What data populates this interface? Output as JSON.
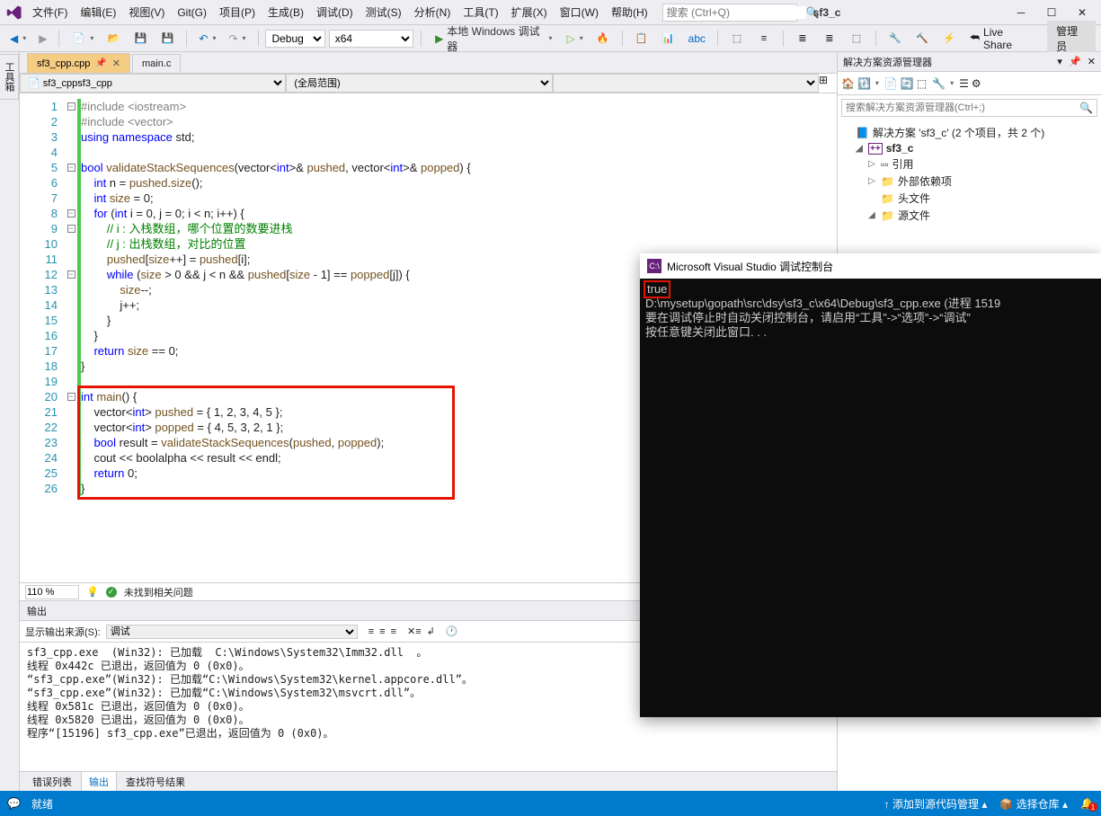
{
  "menu": {
    "items": [
      "文件(F)",
      "编辑(E)",
      "视图(V)",
      "Git(G)",
      "项目(P)",
      "生成(B)",
      "调试(D)",
      "测试(S)",
      "分析(N)",
      "工具(T)",
      "扩展(X)",
      "窗口(W)",
      "帮助(H)"
    ],
    "search_placeholder": "搜索 (Ctrl+Q)",
    "project": "sf3_c"
  },
  "toolbar": {
    "config": "Debug",
    "platform": "x64",
    "debug_label": "本地 Windows 调试器",
    "live_share": "Live Share",
    "admin": "管理员"
  },
  "tabs": {
    "active": "sf3_cpp.cpp",
    "others": [
      "main.c"
    ]
  },
  "nav": {
    "scope": "sf3_cpp",
    "member": "(全局范围)"
  },
  "code": {
    "lines": [
      "#include <iostream>",
      "#include <vector>",
      "using namespace std;",
      "",
      "bool validateStackSequences(vector<int>& pushed, vector<int>& popped) {",
      "    int n = pushed.size();",
      "    int size = 0;",
      "    for (int i = 0, j = 0; i < n; i++) {",
      "        // i : 入栈数组，哪个位置的数要进栈",
      "        // j : 出栈数组，对比的位置",
      "        pushed[size++] = pushed[i];",
      "        while (size > 0 && j < n && pushed[size - 1] == popped[j]) {",
      "            size--;",
      "            j++;",
      "        }",
      "    }",
      "    return size == 0;",
      "}",
      "",
      "int main() {",
      "    vector<int> pushed = { 1, 2, 3, 4, 5 };",
      "    vector<int> popped = { 4, 5, 3, 2, 1 };",
      "    bool result = validateStackSequences(pushed, popped);",
      "    cout << boolalpha << result << endl;",
      "    return 0;",
      "}"
    ]
  },
  "zoom": {
    "percent": "110 %",
    "issues": "未找到相关问题"
  },
  "output": {
    "title": "输出",
    "src_label": "显示输出来源(S):",
    "src_value": "调试",
    "body": "sf3_cpp.exe  (Win32): 已加载  C:\\Windows\\System32\\Imm32.dll  。\n线程 0x442c 已退出，返回值为 0 (0x0)。\n“sf3_cpp.exe”(Win32): 已加载“C:\\Windows\\System32\\kernel.appcore.dll”。\n“sf3_cpp.exe”(Win32): 已加载“C:\\Windows\\System32\\msvcrt.dll”。\n线程 0x581c 已退出，返回值为 0 (0x0)。\n线程 0x5820 已退出，返回值为 0 (0x0)。\n程序“[15196] sf3_cpp.exe”已退出，返回值为 0 (0x0)。"
  },
  "bottom_tabs": [
    "错误列表",
    "输出",
    "查找符号结果"
  ],
  "solution": {
    "title": "解决方案资源管理器",
    "search_placeholder": "搜索解决方案资源管理器(Ctrl+;)",
    "root": "解决方案 'sf3_c' (2 个项目，共 2 个)",
    "project": "sf3_c",
    "refs": "引用",
    "ext_dep": "外部依赖项",
    "headers": "头文件",
    "sources": "源文件"
  },
  "console": {
    "title": "Microsoft Visual Studio 调试控制台",
    "true_text": "true",
    "body": "\nD:\\mysetup\\gopath\\src\\dsy\\sf3_c\\x64\\Debug\\sf3_cpp.exe (进程 1519\n要在调试停止时自动关闭控制台，请启用“工具”->“选项”->“调试”\n按任意键关闭此窗口. . ."
  },
  "status": {
    "ready": "就绪",
    "src_ctrl": "添加到源代码管理",
    "repo": "选择仓库",
    "notif": "1"
  }
}
